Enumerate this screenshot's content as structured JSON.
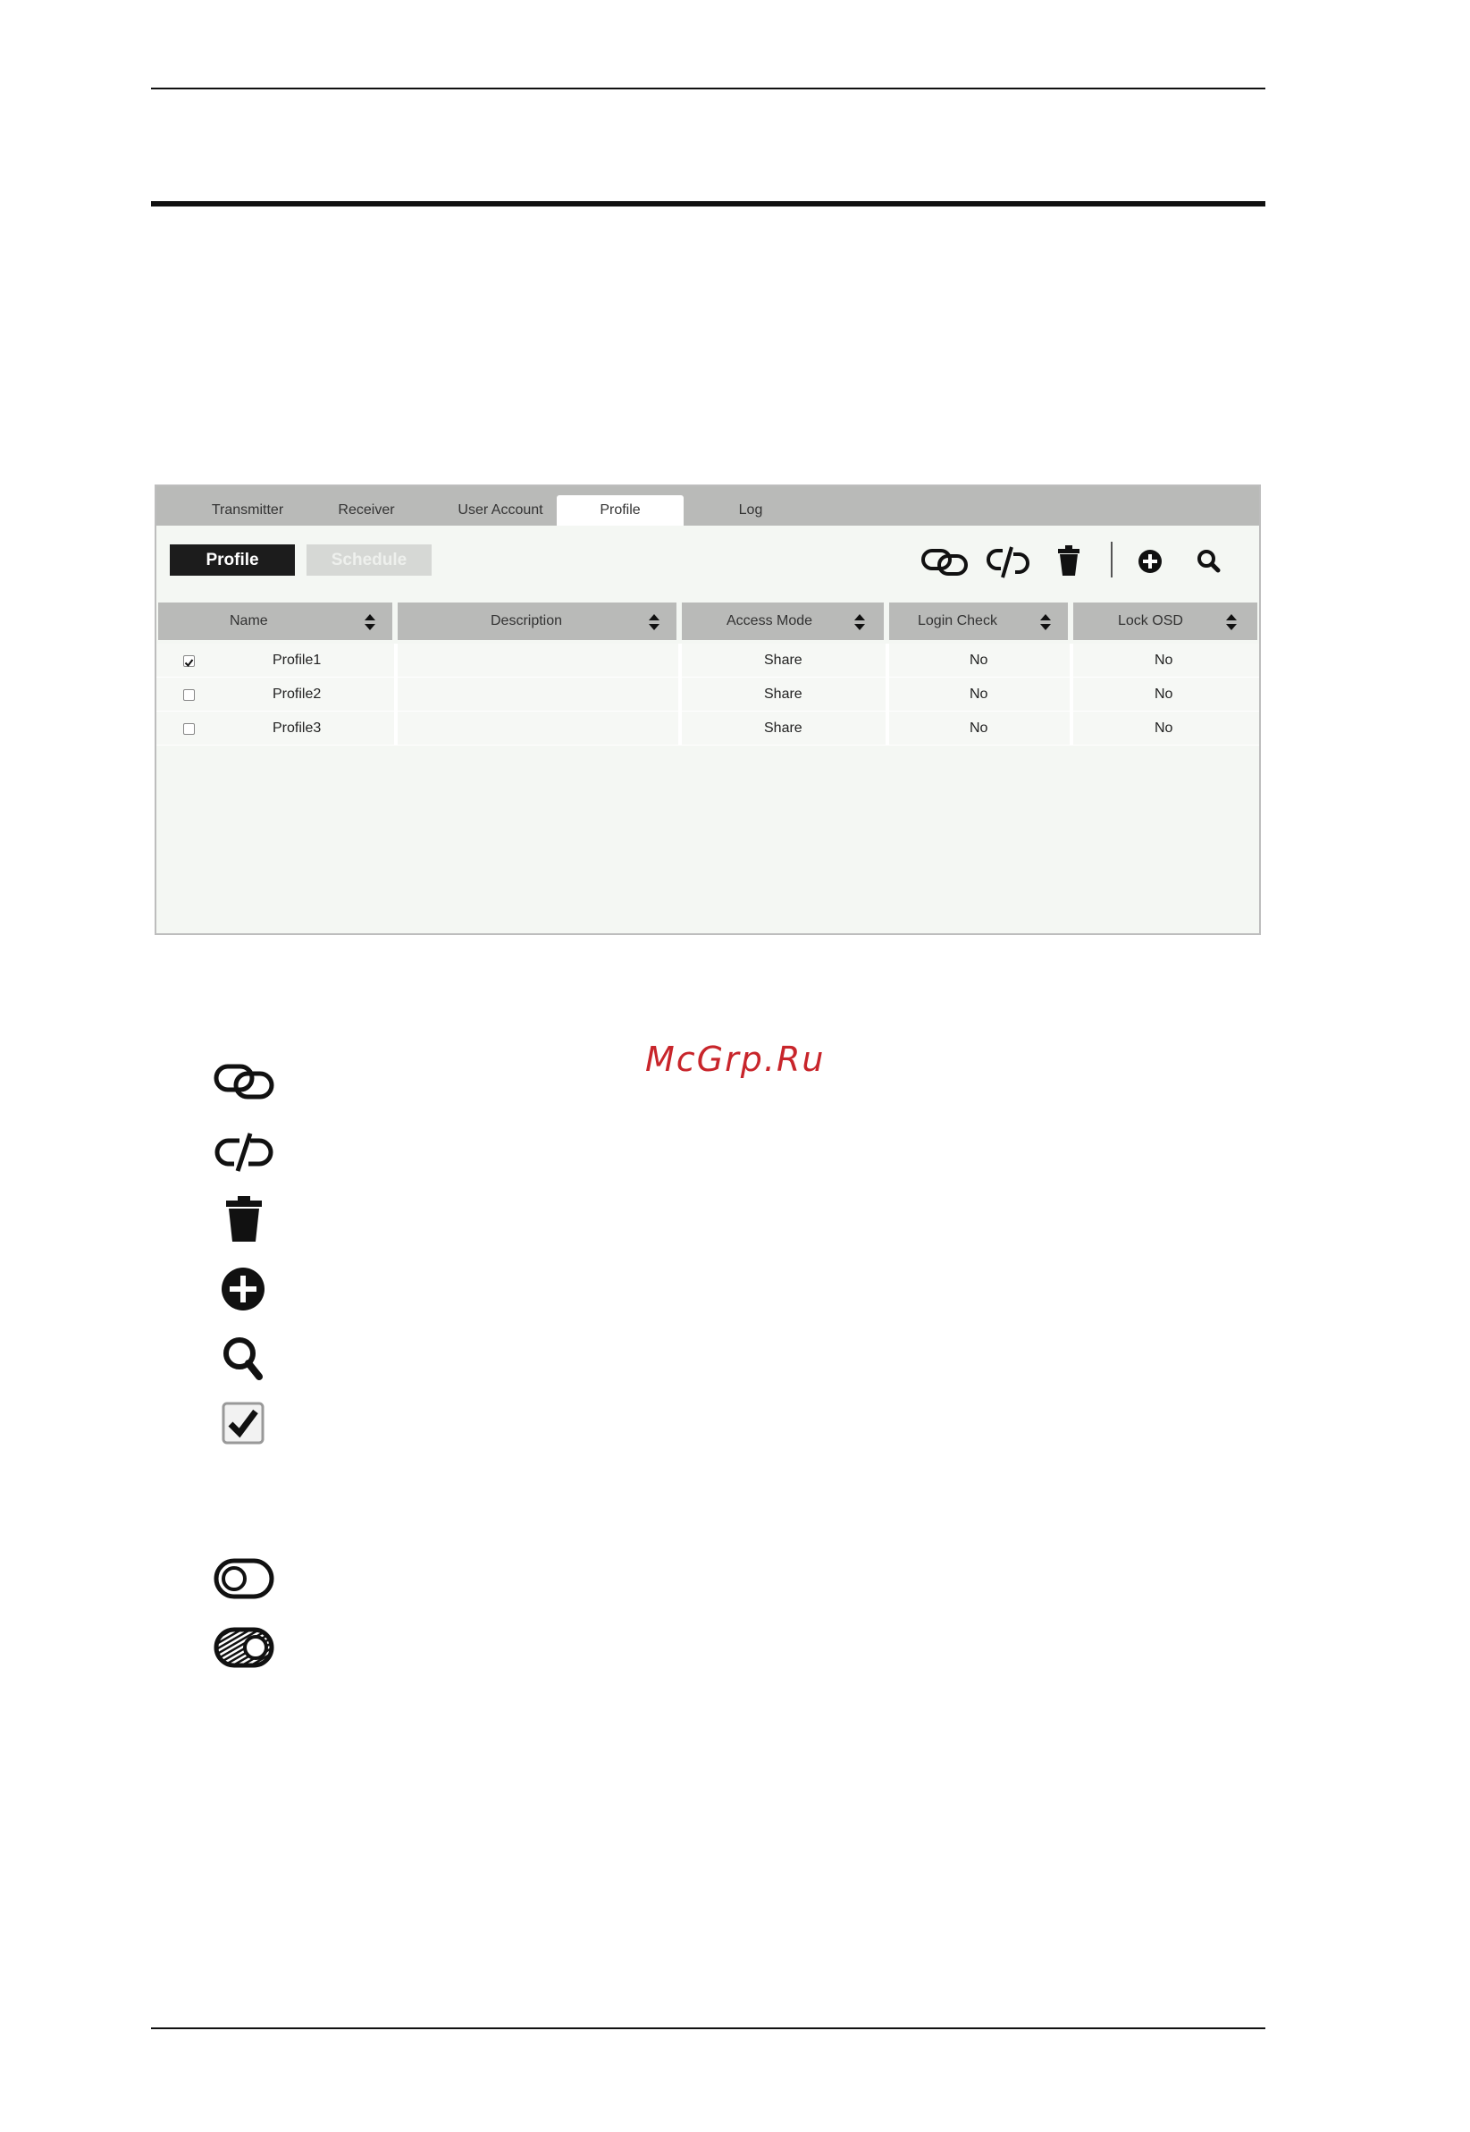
{
  "tabs": [
    {
      "label": "Transmitter"
    },
    {
      "label": "Receiver"
    },
    {
      "label": "User Account"
    },
    {
      "label": "Profile"
    },
    {
      "label": "Log"
    }
  ],
  "active_tab": "Profile",
  "subtabs": {
    "profile": "Profile",
    "schedule": "Schedule"
  },
  "toolbar_icons": [
    "link-icon",
    "unlink-icon",
    "trash-icon",
    "add-circle-icon",
    "search-icon"
  ],
  "columns": [
    {
      "label": "Name"
    },
    {
      "label": "Description"
    },
    {
      "label": "Access Mode"
    },
    {
      "label": "Login Check"
    },
    {
      "label": "Lock OSD"
    }
  ],
  "rows": [
    {
      "checked": true,
      "name": "Profile1",
      "description": "",
      "access_mode": "Share",
      "login_check": "No",
      "lock_osd": "No"
    },
    {
      "checked": false,
      "name": "Profile2",
      "description": "",
      "access_mode": "Share",
      "login_check": "No",
      "lock_osd": "No"
    },
    {
      "checked": false,
      "name": "Profile3",
      "description": "",
      "access_mode": "Share",
      "login_check": "No",
      "lock_osd": "No"
    }
  ],
  "watermark": "McGrp.Ru",
  "legend_icons": [
    "link-icon",
    "unlink-icon",
    "trash-icon",
    "add-circle-icon",
    "search-icon",
    "checkbox-checked-icon",
    "toggle-off-icon",
    "toggle-on-icon"
  ]
}
